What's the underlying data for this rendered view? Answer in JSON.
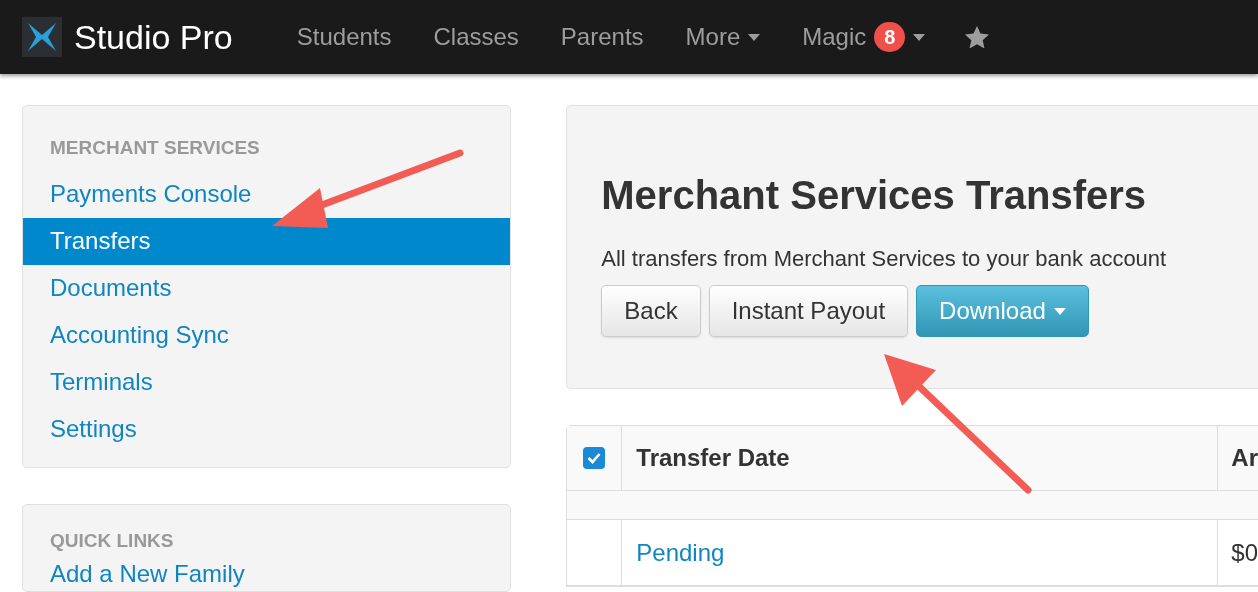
{
  "navbar": {
    "brand": "Studio Pro",
    "items": [
      {
        "label": "Students",
        "dropdown": false
      },
      {
        "label": "Classes",
        "dropdown": false
      },
      {
        "label": "Parents",
        "dropdown": false
      },
      {
        "label": "More",
        "dropdown": true
      },
      {
        "label": "Magic",
        "dropdown": true,
        "badge": "8"
      }
    ]
  },
  "sidebar": {
    "sections": [
      {
        "heading": "MERCHANT SERVICES",
        "items": [
          {
            "label": "Payments Console",
            "selected": false
          },
          {
            "label": "Transfers",
            "selected": true
          },
          {
            "label": "Documents",
            "selected": false
          },
          {
            "label": "Accounting Sync",
            "selected": false
          },
          {
            "label": "Terminals",
            "selected": false
          },
          {
            "label": "Settings",
            "selected": false
          }
        ]
      },
      {
        "heading": "QUICK LINKS",
        "items": [
          {
            "label": "Add a New Family",
            "selected": false
          }
        ]
      }
    ]
  },
  "main": {
    "title": "Merchant Services Transfers",
    "description": "All transfers from Merchant Services to your bank account",
    "buttons": [
      {
        "label": "Back",
        "kind": "default"
      },
      {
        "label": "Instant Payout",
        "kind": "default"
      },
      {
        "label": "Download",
        "kind": "dropdown"
      }
    ]
  },
  "table": {
    "select_all": {
      "checked": true
    },
    "columns": [
      "Transfer Date",
      "Ar"
    ],
    "rows": [
      {
        "cells": [
          "",
          ""
        ]
      },
      {
        "cells": [
          "Pending",
          "$0"
        ]
      }
    ]
  }
}
